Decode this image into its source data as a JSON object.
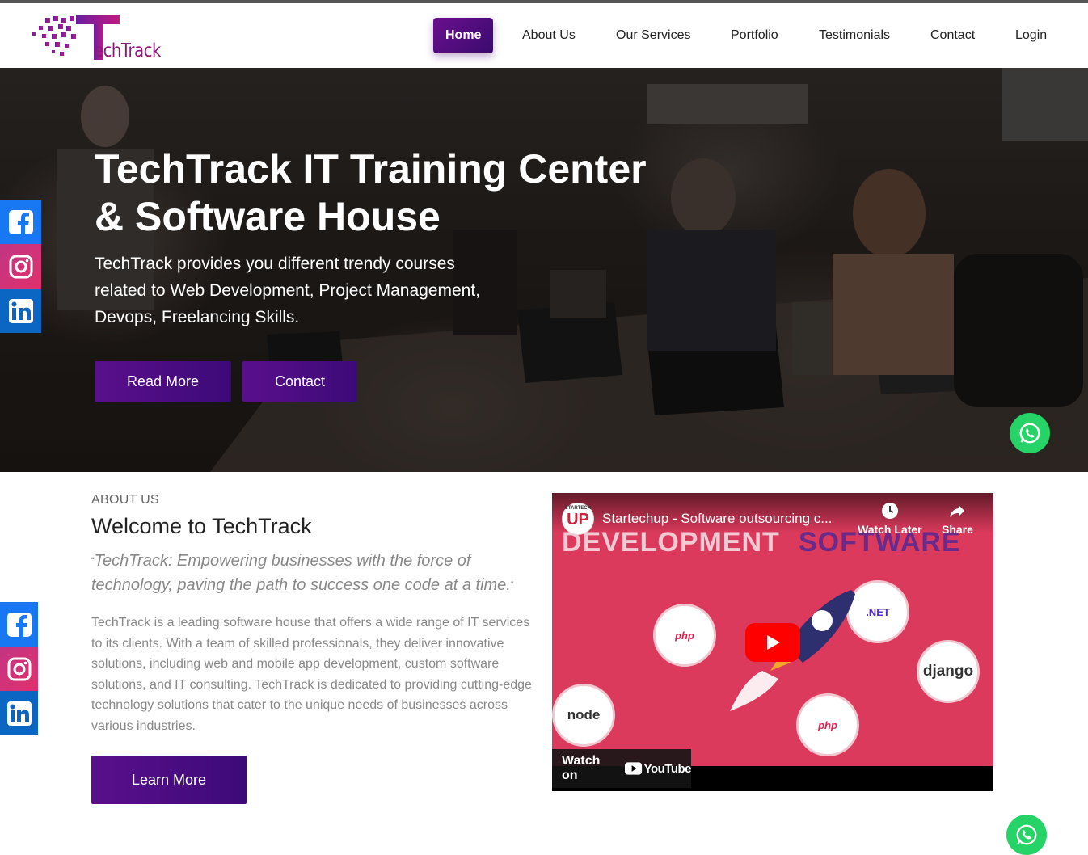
{
  "brand": {
    "logo_text": "echTrack",
    "logo_letter": "T"
  },
  "nav": {
    "items": [
      {
        "label": "Home",
        "active": true
      },
      {
        "label": "About Us"
      },
      {
        "label": "Our Services"
      },
      {
        "label": "Portfolio"
      },
      {
        "label": "Testimonials"
      },
      {
        "label": "Contact"
      },
      {
        "label": "Login"
      }
    ]
  },
  "hero": {
    "title_line1": "TechTrack IT Training Center",
    "title_line2": "& Software House",
    "subtitle_line1": "TechTrack provides you different trendy courses",
    "subtitle_line2": "related to Web Development, Project Management,",
    "subtitle_line3": "Devops, Freelancing Skills.",
    "read_more_label": "Read More",
    "contact_label": "Contact"
  },
  "social": {
    "items": [
      "facebook-icon",
      "instagram-icon",
      "linkedin-icon"
    ]
  },
  "about": {
    "label": "ABOUT US",
    "title": "Welcome to TechTrack",
    "quote_open": "“",
    "quote": "TechTrack: Empowering businesses with the force of technology, paving the path to success one code at a time.",
    "quote_close": "”",
    "body": "TechTrack is a leading software house that offers a wide range of IT services to its clients. With a team of skilled professionals, they deliver innovative solutions, including web and mobile app development, custom software solutions, and IT consulting. TechTrack is dedicated to providing cutting-edge technology solutions that cater to the unique needs of businesses across various industries.",
    "learn_more_label": "Learn More"
  },
  "video": {
    "title": "Startechup - Software outsourcing c...",
    "channel_badge": "UP",
    "channel_badge_small": "STARTECH",
    "thumb_word1": "DEVELOPMENT",
    "thumb_word2": "SOFTWARE",
    "watch_later_label": "Watch Later",
    "share_label": "Share",
    "watch_on_label": "Watch on",
    "youtube_label": "YouTube",
    "tech_labels": {
      "php": "php",
      "dotnet": ".NET",
      "django": "django",
      "node": "node",
      "wordpress": "php"
    },
    "colors": {
      "thumbnail_bg": "#dc3a5c",
      "youtube_red": "#ff0000"
    }
  },
  "colors": {
    "brand_purple": "#5a0f8c",
    "whatsapp": "#25d366",
    "facebook": "#1877f2",
    "linkedin": "#0a66c2"
  }
}
